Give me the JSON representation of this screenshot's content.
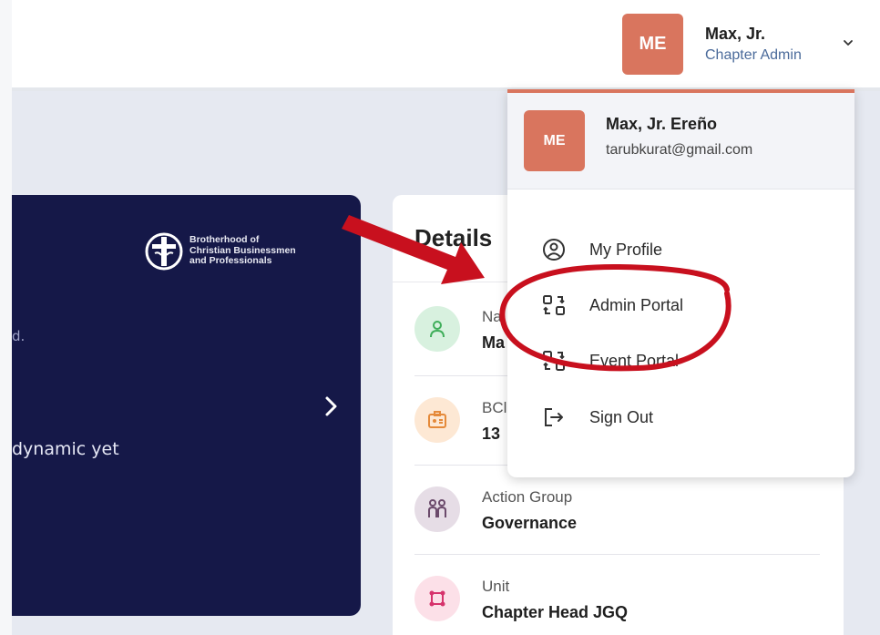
{
  "header": {
    "user": {
      "initials": "ME",
      "name": "Max, Jr.",
      "role": "Chapter Admin"
    }
  },
  "brand_card": {
    "org_name": "Brotherhood of\nChristian Businessmen\nand Professionals",
    "text_partial_1": "d.",
    "text_partial_2": "dynamic yet"
  },
  "details": {
    "title": "Details",
    "rows": [
      {
        "label": "Na",
        "value": "Ma",
        "icon": "person-icon",
        "color": "#d8f1df"
      },
      {
        "label": "BCl",
        "value": "13",
        "icon": "id-card-icon",
        "color": "#fde8d4"
      },
      {
        "label": "Action Group",
        "value": "Governance",
        "icon": "group-icon",
        "color": "#e6dde6"
      },
      {
        "label": "Unit",
        "value": "Chapter Head JGQ",
        "icon": "nodes-icon",
        "color": "#fce0e8"
      }
    ]
  },
  "dropdown": {
    "initials": "ME",
    "full_name": "Max, Jr. Ereño",
    "email": "tarubkurat@gmail.com",
    "items": [
      {
        "label": "My Profile",
        "icon": "user-circle-icon"
      },
      {
        "label": "Admin Portal",
        "icon": "switch-icon"
      },
      {
        "label": "Event Portal",
        "icon": "switch-icon"
      },
      {
        "label": "Sign Out",
        "icon": "sign-out-icon"
      }
    ]
  },
  "colors": {
    "accent": "#d9755e",
    "card_navy": "#151848",
    "annotation_red": "#c8101e"
  }
}
